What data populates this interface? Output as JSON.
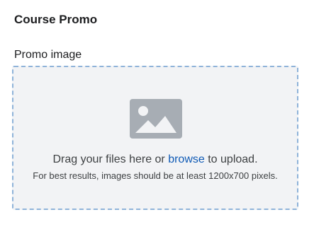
{
  "section": {
    "title": "Course Promo"
  },
  "promo_image": {
    "label": "Promo image",
    "dropzone": {
      "icon": "image-placeholder-icon",
      "text_before": "Drag your files here or ",
      "browse_label": "browse",
      "text_after": " to upload.",
      "hint": "For best results, images should be at least 1200x700 pixels."
    }
  },
  "colors": {
    "link": "#0f5ab5",
    "dropzone_bg": "#f2f3f5",
    "dropzone_border": "#8fb3d9",
    "icon": "#a7adb4"
  }
}
